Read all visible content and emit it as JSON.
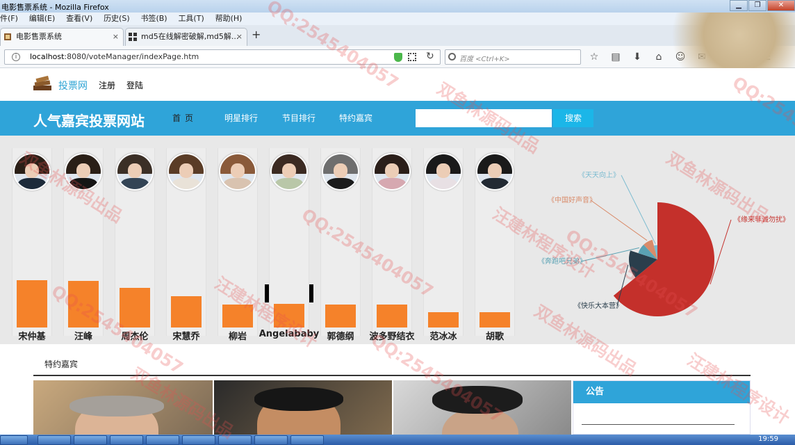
{
  "window": {
    "title": "电影售票系统 - Mozilla Firefox",
    "minimize": "▁",
    "maximize": "❐",
    "close": "✕"
  },
  "menu": [
    "件(F)",
    "编辑(E)",
    "查看(V)",
    "历史(S)",
    "书签(B)",
    "工具(T)",
    "帮助(H)"
  ],
  "tabs": [
    {
      "label": "电影售票系统",
      "close": "×"
    },
    {
      "label": "md5在线解密破解,md5解...",
      "close": "×"
    }
  ],
  "new_tab": "+",
  "address": {
    "host": "localhost",
    "path": ":8080/voteManager/indexPage.htm"
  },
  "browser_search": {
    "placeholder": "百度 <Ctrl+K>"
  },
  "site": {
    "logo_text": "投票网",
    "register": "注册",
    "login": "登陆",
    "title": "人气嘉宾投票网站",
    "nav": [
      "首页",
      "明星排行",
      "节目排行",
      "特约嘉宾"
    ],
    "search_button": "搜索"
  },
  "stars": [
    "宋仲基",
    "汪峰",
    "周杰伦",
    "宋慧乔",
    "柳岩",
    "Angelababy",
    "郭德纲",
    "波多野结衣",
    "范冰冰",
    "胡歌"
  ],
  "chart_data": [
    {
      "type": "bar",
      "categories": [
        "宋仲基",
        "汪峰",
        "周杰伦",
        "宋慧乔",
        "柳岩",
        "Angelababy",
        "郭德纲",
        "波多野结衣",
        "范冰冰",
        "胡歌"
      ],
      "values": [
        68,
        67,
        57,
        45,
        33,
        34,
        33,
        33,
        22,
        22
      ],
      "ylim": [
        0,
        270
      ],
      "tooltip": {
        "category": "Angelababy",
        "value": "34"
      }
    },
    {
      "type": "pie",
      "subtype": "rose",
      "labels": [
        "《天天向上》",
        "《中国好声音》",
        "《奔跑吧兄弟》",
        "《快乐大本营》",
        "《缘来非诚勿扰》"
      ],
      "values": [
        2,
        4,
        4,
        8,
        32
      ],
      "colors": [
        "#7bbbd0",
        "#d98b6a",
        "#5aa2b4",
        "#2a3e4c",
        "#c4302b"
      ]
    }
  ],
  "guests": {
    "title": "特约嘉宾",
    "notice_title": "公告"
  },
  "taskbar": {
    "clock": "19:59"
  },
  "watermarks": [
    "QQ:2545404057",
    "双鱼林源码出品",
    "汪建林程序设计"
  ]
}
